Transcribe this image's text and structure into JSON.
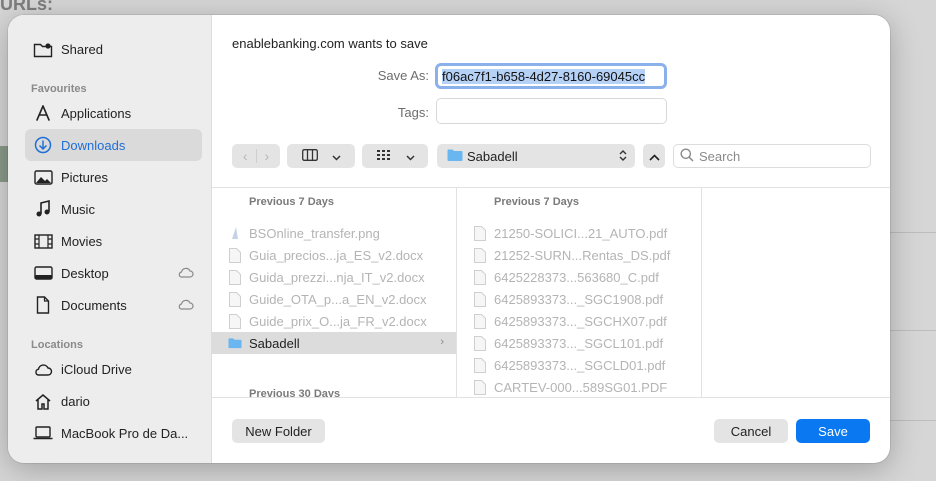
{
  "background": {
    "heading_fragment": "URLs:"
  },
  "sidebar": {
    "top_item": {
      "label": "Shared",
      "icon": "shared-folder-icon"
    },
    "favourites_title": "Favourites",
    "favourites": [
      {
        "label": "Applications",
        "icon": "applications-icon"
      },
      {
        "label": "Downloads",
        "icon": "downloads-icon",
        "selected": true
      },
      {
        "label": "Pictures",
        "icon": "pictures-icon"
      },
      {
        "label": "Music",
        "icon": "music-icon"
      },
      {
        "label": "Movies",
        "icon": "movies-icon"
      },
      {
        "label": "Desktop",
        "icon": "desktop-icon",
        "cloud": true
      },
      {
        "label": "Documents",
        "icon": "documents-icon",
        "cloud": true
      }
    ],
    "locations_title": "Locations",
    "locations": [
      {
        "label": "iCloud Drive",
        "icon": "icloud-icon"
      },
      {
        "label": "dario",
        "icon": "home-icon"
      },
      {
        "label": "MacBook Pro de Da...",
        "icon": "laptop-icon"
      }
    ]
  },
  "dialog": {
    "title": "enablebanking.com wants to save",
    "save_as_label": "Save As:",
    "save_as_value": "f06ac7f1-b658-4d27-8160-69045cc",
    "tags_label": "Tags:",
    "tags_value": "",
    "current_folder": "Sabadell",
    "search_placeholder": "Search",
    "new_folder_label": "New Folder",
    "cancel_label": "Cancel",
    "save_label": "Save"
  },
  "browser": {
    "column1": {
      "header": "Previous 7 Days",
      "files": [
        "BSOnline_transfer.png",
        "Guia_precios...ja_ES_v2.docx",
        "Guida_prezzi...nja_IT_v2.docx",
        "Guide_OTA_p...a_EN_v2.docx",
        "Guide_prix_O...ja_FR_v2.docx"
      ],
      "selected_folder": "Sabadell",
      "header2": "Previous 30 Days"
    },
    "column2": {
      "header": "Previous 7 Days",
      "files": [
        "21250-SOLICI...21_AUTO.pdf",
        "21252-SURN...Rentas_DS.pdf",
        "6425228373...563680_C.pdf",
        "6425893373..._SGC1908.pdf",
        "6425893373..._SGCHX07.pdf",
        "6425893373..._SGCL101.pdf",
        "6425893373..._SGCLD01.pdf",
        "CARTEV-000...589SG01.PDF"
      ]
    }
  }
}
